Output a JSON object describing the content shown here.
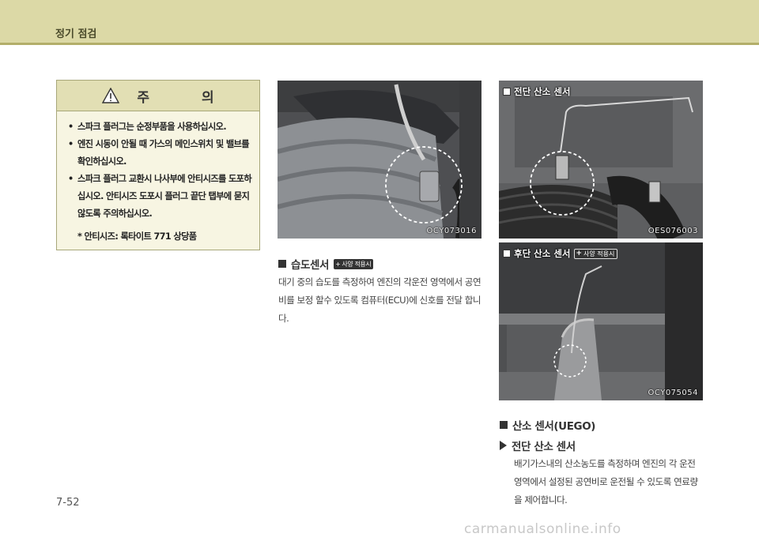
{
  "header": {
    "title": "정기 점검"
  },
  "caution": {
    "title": "주 의",
    "items": [
      "스파크 플러그는 순정부품을 사용하십시오.",
      "엔진 시동이 안될 때 가스의 메인스위치 및 밸브를 확인하십시오.",
      "스파크 플러그 교환시 나사부에 안티시즈를 도포하십시오. 안티시즈 도포시 플러그 끝단 탭부에 묻지 않도록 주의하십시오."
    ],
    "note": "* 안티시즈: 록타이트 771 상당품"
  },
  "humidity": {
    "photo_code": "OCY073016",
    "title": "습도센서",
    "badge": "사양 적용시",
    "body": "대기 중의 습도를 측정하여 엔진의 각운전 영역에서 공연비를 보정 할수 있도록 컴퓨터(ECU)에 신호를 전달 합니다."
  },
  "front_sensor_photo": {
    "label": "전단 산소 센서",
    "photo_code": "OES076003"
  },
  "rear_sensor_photo": {
    "label": "후단 산소 센서",
    "badge": "사양 적용시",
    "photo_code": "OCY075054"
  },
  "oxygen": {
    "title": "산소 센서(UEGO)",
    "subtitle": "전단 산소 센서",
    "body": "배기가스내의 산소농도를 측정하며 엔진의 각 운전 영역에서 설정된 공연비로 운전될 수 있도록 연료량을 제어합니다."
  },
  "page_number": "7-52",
  "watermark": "carmanualsonline.info"
}
